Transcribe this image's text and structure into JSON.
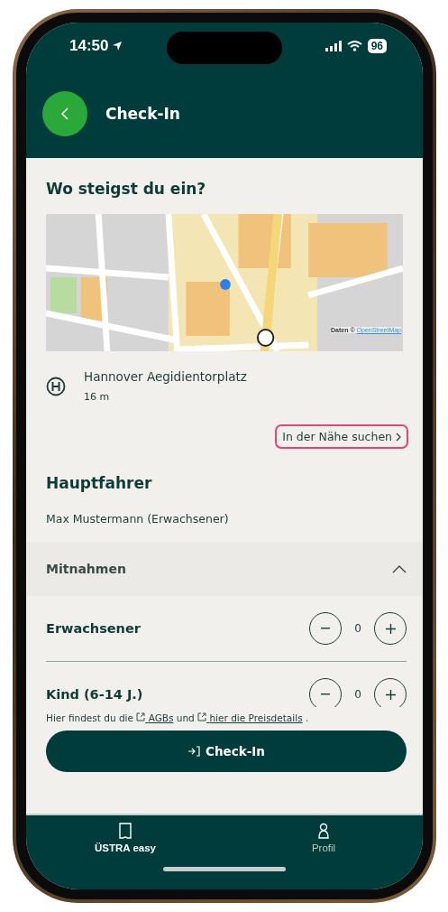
{
  "status_bar": {
    "time": "14:50",
    "battery": "96"
  },
  "header": {
    "title": "Check-In"
  },
  "section_title": "Wo steigst du ein?",
  "map": {
    "attribution_prefix": "Daten ©",
    "attribution_link": "OpenStreetMap"
  },
  "stop": {
    "name": "Hannover Aegidientorplatz",
    "distance": "16 m"
  },
  "nearby_link": "In der Nähe suchen",
  "main_rider": {
    "title": "Hauptfahrer",
    "name": "Max Mustermann (Erwachsener)"
  },
  "companions": {
    "title": "Mitnahmen",
    "expanded": true,
    "rows": [
      {
        "label": "Erwachsener",
        "count": "0"
      },
      {
        "label": "Kind (6-14 J.)",
        "count": "0"
      }
    ]
  },
  "footer": {
    "text_before": "Hier findest du die",
    "link_1": "AGBs",
    "text_middle": "und",
    "link_2": "hier die Preisdetails",
    "text_end": ".",
    "button": "Check-In"
  },
  "tab_bar": [
    {
      "label": "ÜSTRA easy",
      "selected": true
    },
    {
      "label": "Profil",
      "selected": false
    }
  ]
}
